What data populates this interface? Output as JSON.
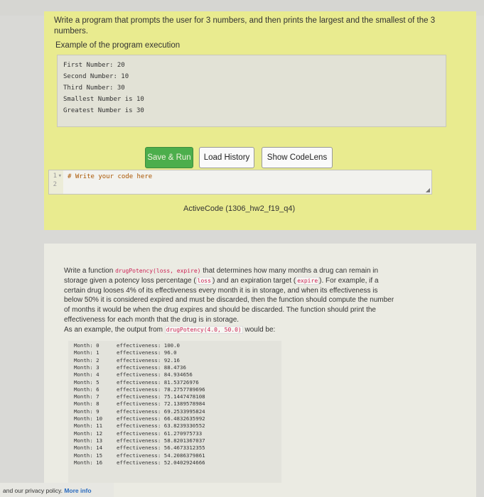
{
  "problem1": {
    "prompt": "Write a program that prompts the user for 3 numbers, and then prints the largest and the smallest of the 3 numbers.",
    "example_heading": "Example of the program execution",
    "example_lines": [
      "First Number: 20",
      "Second Number: 10",
      "Third Number: 30",
      "Smallest Number is 10",
      "Greatest Number is 30"
    ],
    "buttons": {
      "save_run": "Save & Run",
      "load_history": "Load History",
      "show_codelens": "Show CodeLens"
    },
    "editor": {
      "line_numbers": [
        "1",
        "2"
      ],
      "line_marker": "▾",
      "code": "# Write your code here"
    },
    "caption": "ActiveCode (1306_hw2_f19_q4)"
  },
  "problem2": {
    "desc_part1": "Write a function ",
    "func_sig": "drugPotency(loss, expire)",
    "desc_part2": " that determines how many months a drug can remain in storage given a potency loss percentage (",
    "loss": "loss",
    "desc_part3": ") and an expiration target (",
    "expire": "expire",
    "desc_part4": "). For example, if a certain drug looses 4% of its effectiveness every month it is in storage, and when its effectiveness is below 50% it is considered expired and must be discarded, then the function should compute the number of months it would be when the drug expires and should be discarded. The function should print the effectiveness for each month that the drug is in storage.",
    "example_prefix": "As an example, the output from ",
    "example_call": "drugPotency(4.0, 50.0)",
    "example_suffix": " would be:",
    "output": [
      {
        "month": "Month: 0",
        "eff": "effectiveness: 100.0"
      },
      {
        "month": "Month: 1",
        "eff": "effectiveness: 96.0"
      },
      {
        "month": "Month: 2",
        "eff": "effectiveness: 92.16"
      },
      {
        "month": "Month: 3",
        "eff": "effectiveness: 88.4736"
      },
      {
        "month": "Month: 4",
        "eff": "effectiveness: 84.934656"
      },
      {
        "month": "Month: 5",
        "eff": "effectiveness: 81.53726976"
      },
      {
        "month": "Month: 6",
        "eff": "effectiveness: 78.2757789696"
      },
      {
        "month": "Month: 7",
        "eff": "effectiveness: 75.1447478108"
      },
      {
        "month": "Month: 8",
        "eff": "effectiveness: 72.1389578984"
      },
      {
        "month": "Month: 9",
        "eff": "effectiveness: 69.2533995824"
      },
      {
        "month": "Month: 10",
        "eff": "effectiveness: 66.4832635992"
      },
      {
        "month": "Month: 11",
        "eff": "effectiveness: 63.8239330552"
      },
      {
        "month": "Month: 12",
        "eff": "effectiveness: 61.270975733"
      },
      {
        "month": "Month: 13",
        "eff": "effectiveness: 58.8201367037"
      },
      {
        "month": "Month: 14",
        "eff": "effectiveness: 56.4673312355"
      },
      {
        "month": "Month: 15",
        "eff": "effectiveness: 54.2086379861"
      },
      {
        "month": "Month: 16",
        "eff": "effectiveness: 52.0402924666"
      }
    ]
  },
  "footer": {
    "text": "and our privacy policy.",
    "link": "More info"
  }
}
